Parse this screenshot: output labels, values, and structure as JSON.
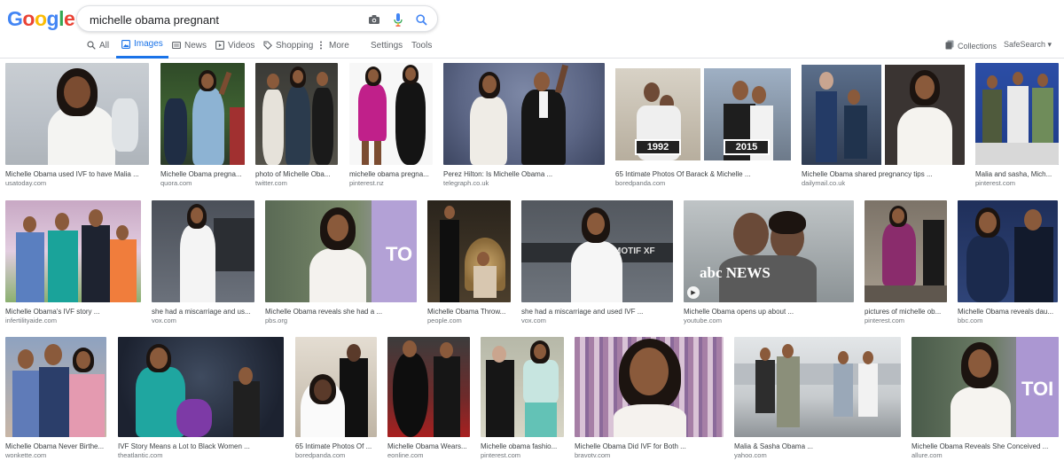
{
  "search": {
    "query": "michelle obama pregnant"
  },
  "tabs": [
    {
      "label": "All"
    },
    {
      "label": "Images"
    },
    {
      "label": "News"
    },
    {
      "label": "Videos"
    },
    {
      "label": "Shopping"
    },
    {
      "label": "More"
    },
    {
      "label": "Settings"
    },
    {
      "label": "Tools"
    }
  ],
  "header": {
    "collections": "Collections",
    "safesearch": "SafeSearch ▾"
  },
  "logo": {
    "letters": [
      "G",
      "o",
      "o",
      "g",
      "l",
      "e"
    ],
    "colors": [
      "#4285F4",
      "#EA4335",
      "#FBBC05",
      "#4285F4",
      "#34A853",
      "#EA4335"
    ]
  },
  "results": [
    {
      "title": "Michelle Obama used IVF to have Malia ...",
      "source": "usatoday.com"
    },
    {
      "title": "Michelle Obama pregna...",
      "source": "quora.com"
    },
    {
      "title": "photo of Michelle Oba...",
      "source": "twitter.com"
    },
    {
      "title": "michelle obama pregna...",
      "source": "pinterest.nz"
    },
    {
      "title": "Perez Hilton: Is Michelle Obama ...",
      "source": "telegraph.co.uk"
    },
    {
      "title": "65 Intimate Photos Of Barack & Michelle ...",
      "source": "boredpanda.com",
      "captions": [
        "1992",
        "2015"
      ]
    },
    {
      "title": "Michelle Obama shared pregnancy tips ...",
      "source": "dailymail.co.uk"
    },
    {
      "title": "Malia and sasha, Mich...",
      "source": "pinterest.com"
    },
    {
      "title": "Michelle Obama's IVF story ...",
      "source": "infertilityaide.com"
    },
    {
      "title": "she had a miscarriage and us...",
      "source": "vox.com"
    },
    {
      "title": "Michelle Obama reveals she had a ...",
      "source": "pbs.org",
      "overlay": "TO"
    },
    {
      "title": "Michelle Obama Throw...",
      "source": "people.com"
    },
    {
      "title": "she had a miscarriage and used IVF ...",
      "source": "vox.com",
      "overlay": "MOTIF XF"
    },
    {
      "title": "Michelle Obama opens up about ...",
      "source": "youtube.com",
      "overlay": "abc NEWS"
    },
    {
      "title": "pictures of michelle ob...",
      "source": "pinterest.com"
    },
    {
      "title": "Michelle Obama reveals dau...",
      "source": "bbc.com"
    },
    {
      "title": "Michelle Obama Never Birthe...",
      "source": "wonkette.com"
    },
    {
      "title": "IVF Story Means a Lot to Black Women ...",
      "source": "theatlantic.com"
    },
    {
      "title": "65 Intimate Photos Of ...",
      "source": "boredpanda.com"
    },
    {
      "title": "Michelle Obama Wears...",
      "source": "eonline.com"
    },
    {
      "title": "Michelle obama fashio...",
      "source": "pinterest.com"
    },
    {
      "title": "Michelle Obama Did IVF for Both ...",
      "source": "bravotv.com"
    },
    {
      "title": "Malia & Sasha Obama ...",
      "source": "yahoo.com"
    },
    {
      "title": "Michelle Obama Reveals She Conceived ...",
      "source": "allure.com",
      "overlay": "TOI"
    }
  ]
}
